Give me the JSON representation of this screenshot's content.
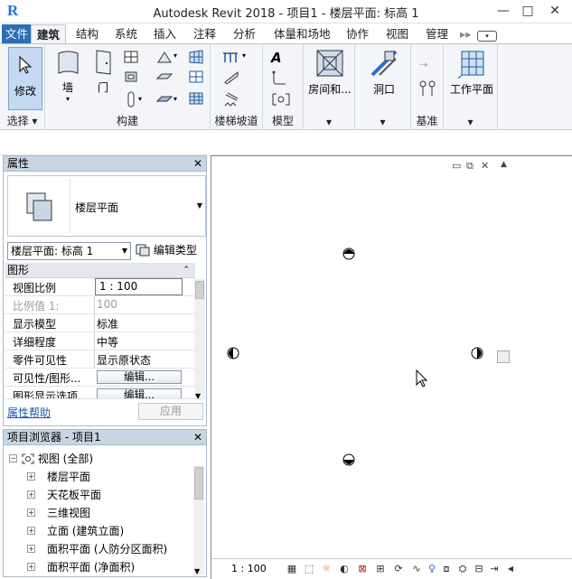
{
  "window": {
    "logo": "R",
    "title": "Autodesk Revit 2018 -    项目1 - 楼层平面: 标高 1",
    "minimize": "—",
    "maximize": "□",
    "close": "✕"
  },
  "tabs": [
    "文件",
    "建筑",
    "结构",
    "系统",
    "插入",
    "注释",
    "分析",
    "体量和场地",
    "协作",
    "视图",
    "管理"
  ],
  "tabs_overflow": "▸▸",
  "ribbon": {
    "modify_label": "修改",
    "wall_label": "墙",
    "door_label": "门",
    "room_label": "房间和...",
    "opening_label": "洞口",
    "workplane_label": "工作平面",
    "groups": {
      "select": "选择",
      "build": "构建",
      "stairs": "楼梯坡道",
      "model": "模型",
      "datum": "基准"
    }
  },
  "properties": {
    "header": "属性",
    "type_name": "楼层平面",
    "selector_value": "楼层平面: 标高 1",
    "edit_type": "编辑类型",
    "category": "图形",
    "rows": [
      {
        "key": "视图比例",
        "value": "1 : 100"
      },
      {
        "key": "比例值 1:",
        "value": "100"
      },
      {
        "key": "显示模型",
        "value": "标准"
      },
      {
        "key": "详细程度",
        "value": "中等"
      },
      {
        "key": "零件可见性",
        "value": "显示原状态"
      },
      {
        "key": "可见性/图形...",
        "value": "编辑..."
      },
      {
        "key": "图形显示选项",
        "value": "编辑..."
      }
    ],
    "help": "属性帮助",
    "apply": "应用"
  },
  "browser": {
    "header": "项目浏览器 - 项目1",
    "root": "视图 (全部)",
    "items": [
      "楼层平面",
      "天花板平面",
      "三维视图",
      "立面 (建筑立面)",
      "面积平面 (人防分区面积)",
      "面积平面 (净面积)"
    ]
  },
  "view": {
    "scale": "1 : 100"
  }
}
